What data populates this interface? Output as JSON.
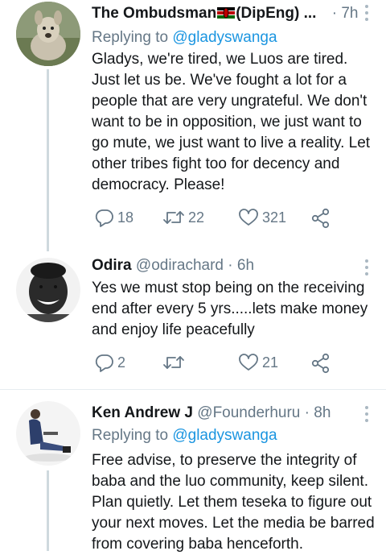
{
  "tweets": [
    {
      "name": "The Ombudsman",
      "name_suffix": "(DipEng)",
      "ellipsis": "...",
      "dot": "·",
      "time": "7h",
      "replying_prefix": "Replying to",
      "replying_to": "@gladyswanga",
      "text": "Gladys, we're tired, we Luos are tired. Just let us be. We've fought a lot for a people that are very ungrateful. We don't want to be in opposition, we just want to go mute, we just want to live a reality. Let other tribes fight too for decency and democracy. Please!",
      "replies": "18",
      "retweets": "22",
      "likes": "321"
    },
    {
      "name": "Odira",
      "handle": "@odirachard",
      "dot": "·",
      "time": "6h",
      "text": "Yes we must stop being on the receiving end after every 5 yrs.....lets make money and enjoy life peacefully",
      "replies": "2",
      "retweets": "",
      "likes": "21"
    },
    {
      "name": "Ken Andrew J",
      "handle": "@Founderhuru",
      "dot": "·",
      "time": "8h",
      "replying_prefix": "Replying to",
      "replying_to": "@gladyswanga",
      "text": "Free advise, to preserve the integrity of baba and the luo community, keep silent. Plan quietly. Let them teseka to figure out your next moves. Let the media be barred from covering baba henceforth."
    }
  ],
  "colors": {
    "text": "#14171a",
    "secondary": "#657786",
    "link": "#1b95e0",
    "thread_line": "#cfd9de",
    "divider": "#e6ecf0"
  }
}
